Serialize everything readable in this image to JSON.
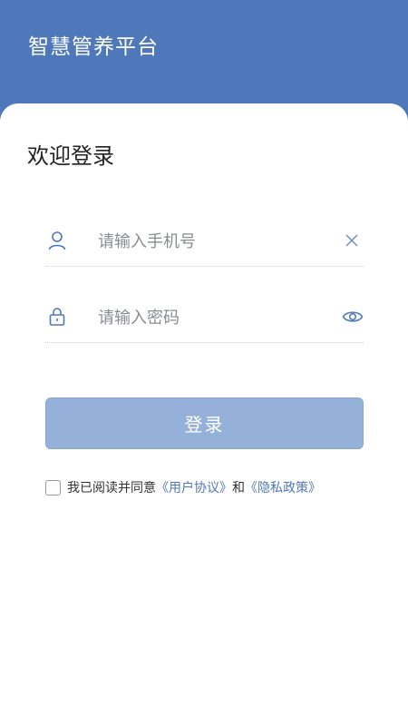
{
  "header": {
    "title": "智慧管养平台"
  },
  "login": {
    "welcome": "欢迎登录",
    "phone_placeholder": "请输入手机号",
    "password_placeholder": "请输入密码",
    "button_label": "登录"
  },
  "agreement": {
    "prefix": "我已阅读并同意",
    "user_agreement": "《用户协议》",
    "conjunction": "和",
    "privacy_policy": "《隐私政策》"
  },
  "colors": {
    "primary": "#4f78ba",
    "button_disabled": "#95b0d9"
  },
  "icons": {
    "phone_field": "user-icon",
    "phone_clear": "clear-icon",
    "password_field": "lock-icon",
    "password_toggle": "eye-icon"
  }
}
